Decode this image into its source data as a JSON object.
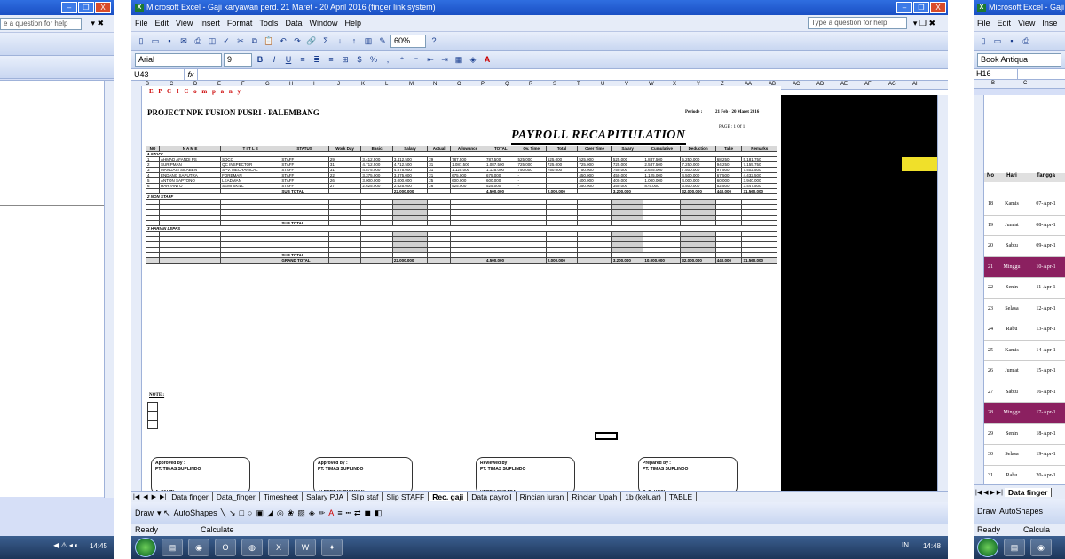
{
  "left_window": {
    "help_placeholder": "e a question for help",
    "clock": "14:45"
  },
  "main_window": {
    "title": "Microsoft Excel - Gaji karyawan perd. 21 Maret - 20 April 2016 (finger link system)",
    "menu": [
      "File",
      "Edit",
      "View",
      "Insert",
      "Format",
      "Tools",
      "Data",
      "Window",
      "Help"
    ],
    "help_placeholder": "Type a question for help",
    "zoom": "60%",
    "font_name": "Arial",
    "font_size": "9",
    "name_box": "U43",
    "fx": "fx",
    "columns": [
      "B",
      "C",
      "D",
      "E",
      "F",
      "G",
      "H",
      "I",
      "J",
      "K",
      "L",
      "M",
      "N",
      "O",
      "P",
      "Q",
      "R",
      "S",
      "T",
      "U",
      "V",
      "W",
      "X",
      "Y",
      "Z",
      "AA",
      "AB",
      "AC",
      "AD",
      "AE",
      "AF",
      "AG",
      "AH"
    ],
    "sheet_tabs": [
      "Data finger",
      "Data_finger",
      "Timesheet",
      "Salary PJA",
      "Slip staf",
      "Slip STAFF",
      "Rec. gaji",
      "Data payroll",
      "Rincian iuran",
      "Rincian Upah",
      "1b (keluar)",
      "TABLE"
    ],
    "active_tab": "Rec. gaji",
    "draw_label": "Draw",
    "autoshapes_label": "AutoShapes",
    "status": {
      "left": "Ready",
      "mid": "Calculate"
    },
    "clock": "14:48",
    "tray": "IN"
  },
  "document": {
    "company": "E P C I   C o m p a n y",
    "project": "PROJECT NPK FUSION PUSRI - PALEMBANG",
    "periode_label": "Periode :",
    "periode": "21 Feb - 20 Maret 2016",
    "page": "PAGE : 1 Of 1",
    "heading": "PAYROLL RECAPITULATION",
    "headers": [
      "NO",
      "N A M E",
      "T I T L E",
      "STATUS",
      "Work Day",
      "Basic",
      "Salary",
      "Actual",
      "Allowance",
      "TOTAL",
      "Ov. Time",
      "Total",
      "Over Time",
      "Salary",
      "Cumulative",
      "Deduction",
      "Take",
      "Remarks"
    ],
    "sections": [
      {
        "label": "1   STAFF",
        "rows": [
          {
            "no": "1",
            "name": "AHMAD AFANDI PS",
            "title": "SDCC",
            "status": "STAFF",
            "day": "29",
            "basic": "3.412.500",
            "salary": "3.412.500",
            "actual": "29",
            "meal": "787.500",
            "total1": "787.500",
            "pos": "525.000",
            "total2": "525.000",
            "trans": "525.000",
            "total3": "525.000",
            "allow": "1.837.500",
            "cum": "5.250.000",
            "jht": "68.250",
            "take": "5.181.750"
          },
          {
            "no": "2",
            "name": "SURIPMAN",
            "title": "QC INSPECTOR",
            "status": "STAFF",
            "day": "31",
            "basic": "4.712.500",
            "salary": "4.712.500",
            "actual": "31",
            "meal": "1.087.500",
            "total1": "1.087.500",
            "pos": "725.000",
            "total2": "725.000",
            "trans": "725.000",
            "total3": "725.000",
            "allow": "2.537.500",
            "cum": "7.250.000",
            "jht": "94.250",
            "take": "7.155.750"
          },
          {
            "no": "3",
            "name": "MANGASI SILABEN",
            "title": "SPV. MECHANICAL",
            "status": "STAFF",
            "day": "31",
            "basic": "4.875.000",
            "salary": "4.875.000",
            "actual": "31",
            "meal": "1.125.000",
            "total1": "1.125.000",
            "pos": "750.000",
            "total2": "750.000",
            "trans": "750.000",
            "total3": "750.000",
            "allow": "2.625.000",
            "cum": "7.500.000",
            "jht": "97.500",
            "take": "7.402.500"
          },
          {
            "no": "4",
            "name": "ENDANG SAPUTRA",
            "title": "FOREMAN",
            "status": "STAFF",
            "day": "22",
            "basic": "3.375.000",
            "salary": "3.375.000",
            "actual": "21",
            "meal": "675.000",
            "total1": "675.000",
            "pos": "-",
            "total2": "-",
            "trans": "450.000",
            "total3": "450.000",
            "allow": "1.125.000",
            "cum": "4.500.000",
            "jht": "67.500",
            "take": "4.432.500"
          },
          {
            "no": "5",
            "name": "ANTON SAPTONO",
            "title": "LEADMAN",
            "status": "STAFF",
            "day": "26",
            "basic": "3.000.000",
            "salary": "3.000.000",
            "actual": "25",
            "meal": "600.000",
            "total1": "600.000",
            "pos": "-",
            "total2": "-",
            "trans": "400.000",
            "total3": "400.000",
            "allow": "1.000.000",
            "cum": "4.000.000",
            "jht": "60.000",
            "take": "3.940.000"
          },
          {
            "no": "6",
            "name": "HARYANTO",
            "title": "SEMI SKILL",
            "status": "STAFF",
            "day": "27",
            "basic": "2.625.000",
            "salary": "2.625.000",
            "actual": "26",
            "meal": "525.000",
            "total1": "525.000",
            "pos": "-",
            "total2": "-",
            "trans": "350.000",
            "total3": "350.000",
            "allow": "875.000",
            "cum": "3.500.000",
            "jht": "52.500",
            "take": "3.447.500"
          }
        ],
        "subtotal": {
          "label": "SUB TOTAL",
          "salary": "22.000.000",
          "total1": "4.500.000",
          "total2": "2.000.000",
          "total3": "3.200.000",
          "cum": "32.000.000",
          "jht": "440.000",
          "take": "31.560.000"
        }
      },
      {
        "label": "2   NON STAFF",
        "subtotal_label": "SUB TOTAL"
      },
      {
        "label": "3   HARIAN LEPAS",
        "subtotal_label": "SUB TOTAL"
      }
    ],
    "grand": {
      "label": "GRAND TOTAL",
      "salary": "22.000.000",
      "total1": "4.500.000",
      "total2": "2.000.000",
      "total3": "3.200.000",
      "allow": "10.000.000",
      "cum": "32.000.000",
      "jht": "440.000",
      "take": "31.560.000"
    },
    "note": "NOTE :",
    "signatures": [
      {
        "role": "Approved by  :",
        "company": "PT. TIMAS SUPLINDO",
        "person": "A. FAUZI"
      },
      {
        "role": "Approved by  :",
        "company": "PT. TIMAS SUPLINDO",
        "person": "ALBERT KURNIAWAN"
      },
      {
        "role": "Reviewed by  :",
        "company": "PT. TIMAS SUPLINDO",
        "person": "HERDY SUGARA"
      },
      {
        "role": "Prepared by  :",
        "company": "PT. TIMAS SUPLINDO",
        "person": "B. B. HOSI"
      }
    ]
  },
  "right_window": {
    "title": "Microsoft Excel - Gaji ka",
    "menu": [
      "File",
      "Edit",
      "View",
      "Inse"
    ],
    "font": "Book Antiqua",
    "name_box": "H16",
    "col_headers": [
      "B",
      "C"
    ],
    "header_row": [
      "No",
      "Hari",
      "Tangga"
    ],
    "rows": [
      {
        "no": "18",
        "day": "Kamis",
        "date": "07-Apr-1"
      },
      {
        "no": "19",
        "day": "Jum'at",
        "date": "08-Apr-1"
      },
      {
        "no": "20",
        "day": "Sabtu",
        "date": "09-Apr-1"
      },
      {
        "no": "21",
        "day": "Minggu",
        "date": "10-Apr-1",
        "holiday": true
      },
      {
        "no": "22",
        "day": "Senin",
        "date": "11-Apr-1"
      },
      {
        "no": "23",
        "day": "Selasa",
        "date": "12-Apr-1"
      },
      {
        "no": "24",
        "day": "Rabu",
        "date": "13-Apr-1"
      },
      {
        "no": "25",
        "day": "Kamis",
        "date": "14-Apr-1"
      },
      {
        "no": "26",
        "day": "Jum'at",
        "date": "15-Apr-1"
      },
      {
        "no": "27",
        "day": "Sabtu",
        "date": "16-Apr-1"
      },
      {
        "no": "28",
        "day": "Minggu",
        "date": "17-Apr-1",
        "holiday": true
      },
      {
        "no": "29",
        "day": "Senin",
        "date": "18-Apr-1"
      },
      {
        "no": "30",
        "day": "Selasa",
        "date": "19-Apr-1"
      },
      {
        "no": "31",
        "day": "Rabu",
        "date": "20-Apr-1"
      }
    ],
    "tab": "Data finger",
    "status": {
      "left": "Ready",
      "mid": "Calcula"
    }
  }
}
